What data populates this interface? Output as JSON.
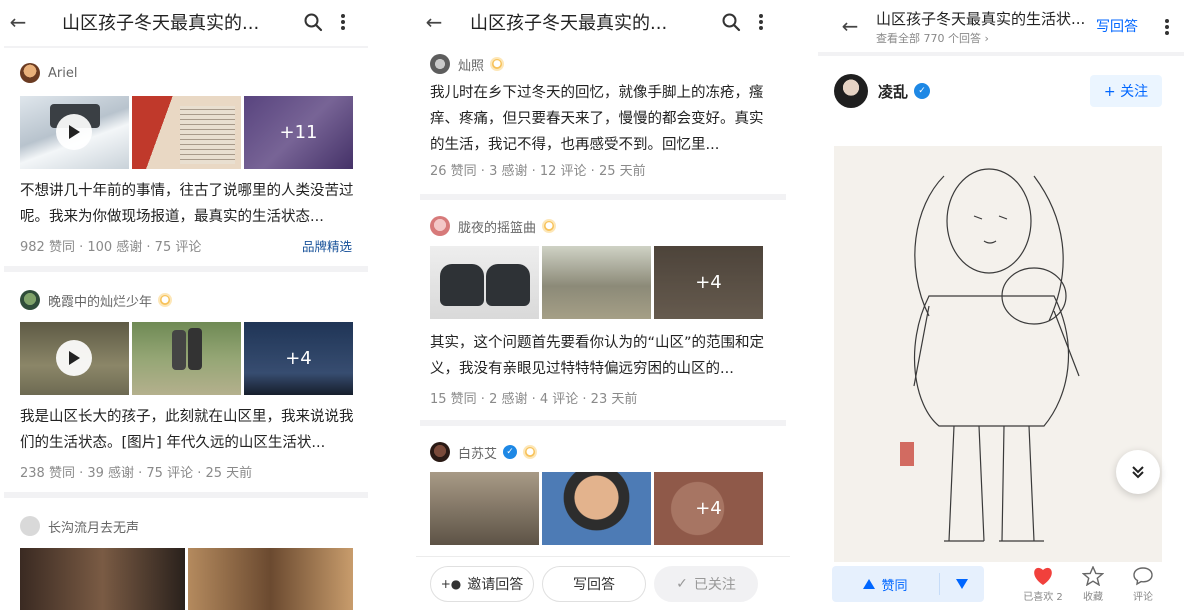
{
  "panel1": {
    "title": "山区孩子冬天最真实的...",
    "answers": [
      {
        "author": "Ariel",
        "more_count": "+11",
        "text": "不想讲几十年前的事情，往古了说哪里的人类没苦过呢。我来为你做现场报道，最真实的生活状态...",
        "meta": "982 赞同 · 100 感谢 · 75 评论",
        "tag": "品牌精选"
      },
      {
        "author": "晚霞中的灿烂少年",
        "more_count": "+4",
        "text": "我是山区长大的孩子，此刻就在山区里，我来说说我们的生活状态。[图片] 年代久远的山区生活状...",
        "meta": "238 赞同 · 39 感谢 · 75 评论 · 25 天前"
      },
      {
        "author": "长沟流月去无声"
      }
    ]
  },
  "panel2": {
    "title": "山区孩子冬天最真实的...",
    "answers": [
      {
        "author": "灿照",
        "text": "我儿时在乡下过冬天的回忆，就像手脚上的冻疮，瘙痒、疼痛，但只要春天来了，慢慢的都会变好。真实的生活，我记不得，也再感受不到。回忆里...",
        "meta": "26 赞同 · 3 感谢 · 12 评论 · 25 天前"
      },
      {
        "author": "胧夜的摇篮曲",
        "more_count": "+4",
        "text": "其实，这个问题首先要看你认为的“山区”的范围和定义，我没有亲眼见过特特特偏远穷困的山区的...",
        "meta": "15 赞同 · 2 感谢 · 4 评论 · 23 天前"
      },
      {
        "author": "白苏艾",
        "more_count": "+4"
      }
    ],
    "bottom": {
      "invite": "邀请回答",
      "write": "写回答",
      "followed": "已关注"
    }
  },
  "panel3": {
    "title": "山区孩子冬天最真实的生活状...",
    "subtitle": "查看全部 770 个回答 ›",
    "write": "写回答",
    "author": "凌乱",
    "follow": "+ 关注",
    "vote_up": "赞同",
    "liked": "已喜欢 2",
    "collect": "收藏",
    "comment": "评论"
  },
  "colors": {
    "accent": "#0066ff",
    "brand_tag": "#175199",
    "like": "#f1403c"
  }
}
